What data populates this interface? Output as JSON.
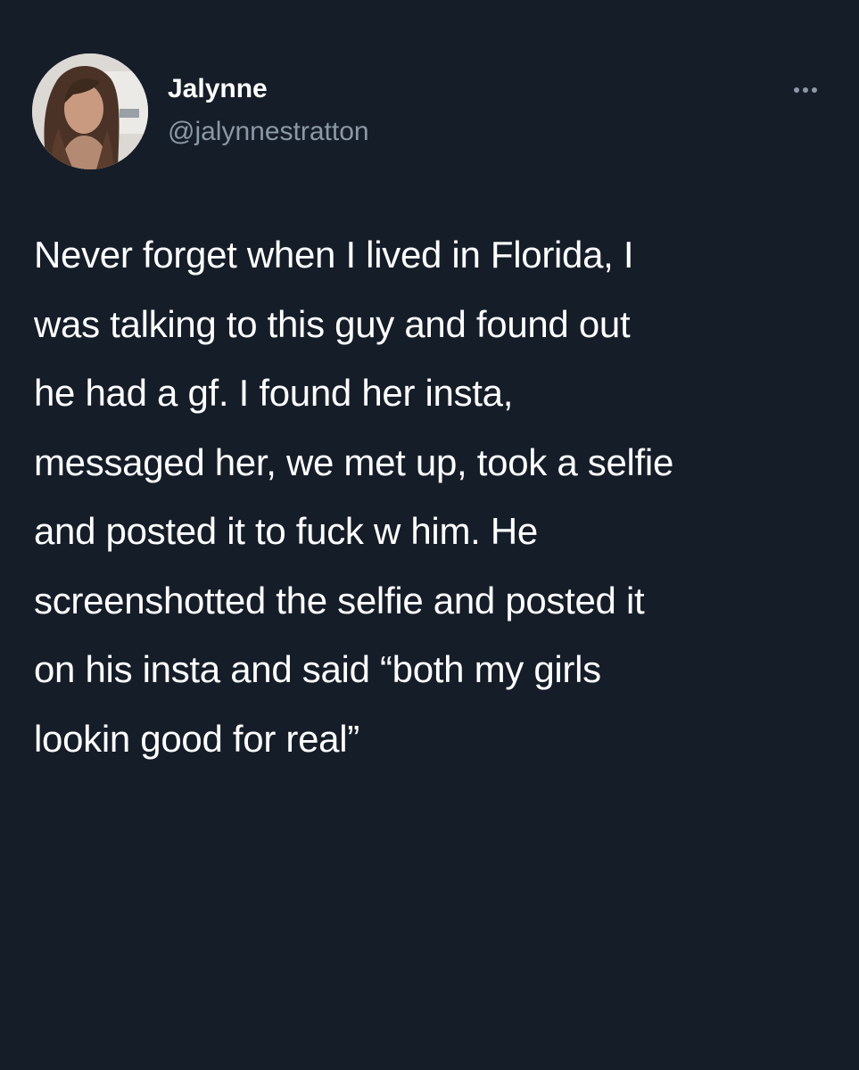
{
  "tweet": {
    "author": {
      "display_name": "Jalynne",
      "handle": "@jalynnestratton",
      "avatar_icon": "user-avatar-photo"
    },
    "more_icon": "more-options-icon",
    "text_lines": [
      "Never forget when I lived in Florida, I",
      "was talking to this guy and found out",
      "he had a gf. I found her insta,",
      "messaged her, we met up, took a selfie",
      "and posted it to fuck w him. He",
      "screenshotted the selfie and posted it",
      "on his insta and said “both my girls",
      "lookin good for real”"
    ]
  },
  "colors": {
    "background": "#151d29",
    "primary_text": "#ffffff",
    "secondary_text": "#8b98a5"
  }
}
